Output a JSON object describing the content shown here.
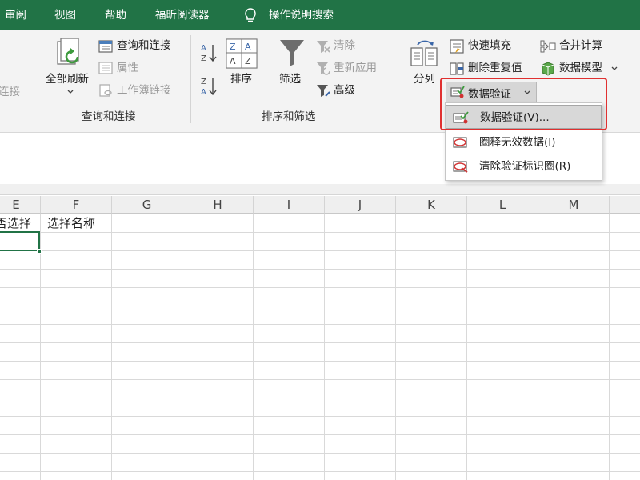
{
  "menubar": {
    "items": [
      "审阅",
      "视图",
      "帮助",
      "福昕阅读器"
    ],
    "tell_me": "操作说明搜索",
    "bg_color": "#217346"
  },
  "ribbon": {
    "left_edge_label": "连接",
    "refresh_all": "全部刷新",
    "query_connect": "查询和连接",
    "properties": "属性",
    "edit_links": "工作簿链接",
    "group_query": "查询和连接",
    "sort": "排序",
    "filter": "筛选",
    "clear": "清除",
    "reapply": "重新应用",
    "advanced": "高级",
    "group_sort_filter": "排序和筛选",
    "text_to_columns": "分列",
    "flash_fill": "快速填充",
    "remove_duplicates": "删除重复值",
    "data_validation": "数据验证",
    "consolidate": "合并计算",
    "data_model": "数据模型"
  },
  "dropdown": {
    "items": [
      "数据验证(V)...",
      "圈释无效数据(I)",
      "清除验证标识圈(R)"
    ],
    "highlight_color": "#e03030"
  },
  "grid": {
    "columns": [
      "E",
      "F",
      "G",
      "H",
      "I",
      "J",
      "K",
      "L",
      "M"
    ],
    "cells": {
      "e1": "否选择",
      "f1": "选择名称"
    },
    "selection_color": "#217346"
  }
}
